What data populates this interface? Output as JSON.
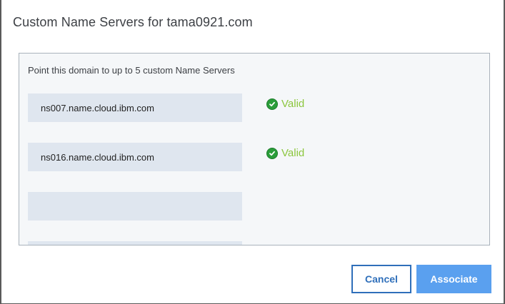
{
  "dialog": {
    "title": "Custom Name Servers for tama0921.com"
  },
  "panel": {
    "instruction": "Point this domain to up to 5 custom Name Servers",
    "name_servers": [
      {
        "value": "ns007.name.cloud.ibm.com",
        "status": "Valid"
      },
      {
        "value": "ns016.name.cloud.ibm.com",
        "status": "Valid"
      },
      {
        "value": ""
      },
      {
        "value": ""
      }
    ],
    "status_icon": "check-circle-icon",
    "colors": {
      "valid_text": "#8cc63e",
      "valid_icon": "#2a9d3a"
    }
  },
  "footer": {
    "cancel_label": "Cancel",
    "associate_label": "Associate",
    "colors": {
      "primary": "#5aa0ef",
      "secondary_border": "#2f6fba"
    }
  }
}
